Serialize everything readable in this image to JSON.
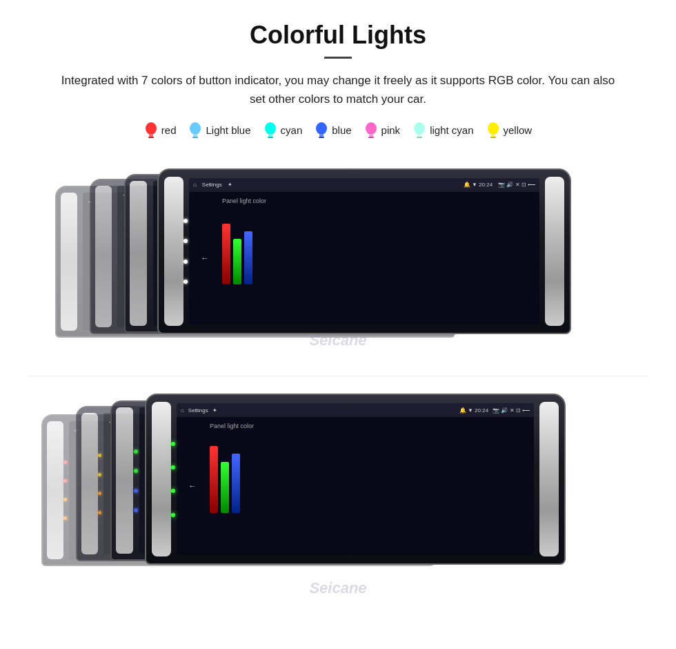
{
  "header": {
    "title": "Colorful Lights",
    "description": "Integrated with 7 colors of button indicator, you may change it freely as it supports RGB color. You can also set other colors to match your car."
  },
  "colors": [
    {
      "name": "red",
      "hex": "#ff2222",
      "bulb_color": "#ff3333"
    },
    {
      "name": "Light blue",
      "hex": "#66ccff",
      "bulb_color": "#66ccff"
    },
    {
      "name": "cyan",
      "hex": "#00ffee",
      "bulb_color": "#00ffee"
    },
    {
      "name": "blue",
      "hex": "#3366ff",
      "bulb_color": "#3366ff"
    },
    {
      "name": "pink",
      "hex": "#ff66cc",
      "bulb_color": "#ff66cc"
    },
    {
      "name": "light cyan",
      "hex": "#aaffee",
      "bulb_color": "#aaffee"
    },
    {
      "name": "yellow",
      "hex": "#ffee00",
      "bulb_color": "#ffee00"
    }
  ],
  "watermark": "Seicane",
  "screen": {
    "title": "Settings",
    "time": "20:24",
    "panel_label": "Panel light color"
  },
  "swatches_top": [
    "#ff2222",
    "#22cc22",
    "#3355ff",
    "#ff8888",
    "#88dd88",
    "#8899ff",
    "#ffcc00",
    "#ffffff",
    "#ff44ff"
  ],
  "swatches_bottom": [
    "#ff2222",
    "#22cc22",
    "#3355ff",
    "#ff8888",
    "#88dd88",
    "#8899ff",
    "#ffcc00",
    "#ffffff",
    "#ff44ff"
  ]
}
